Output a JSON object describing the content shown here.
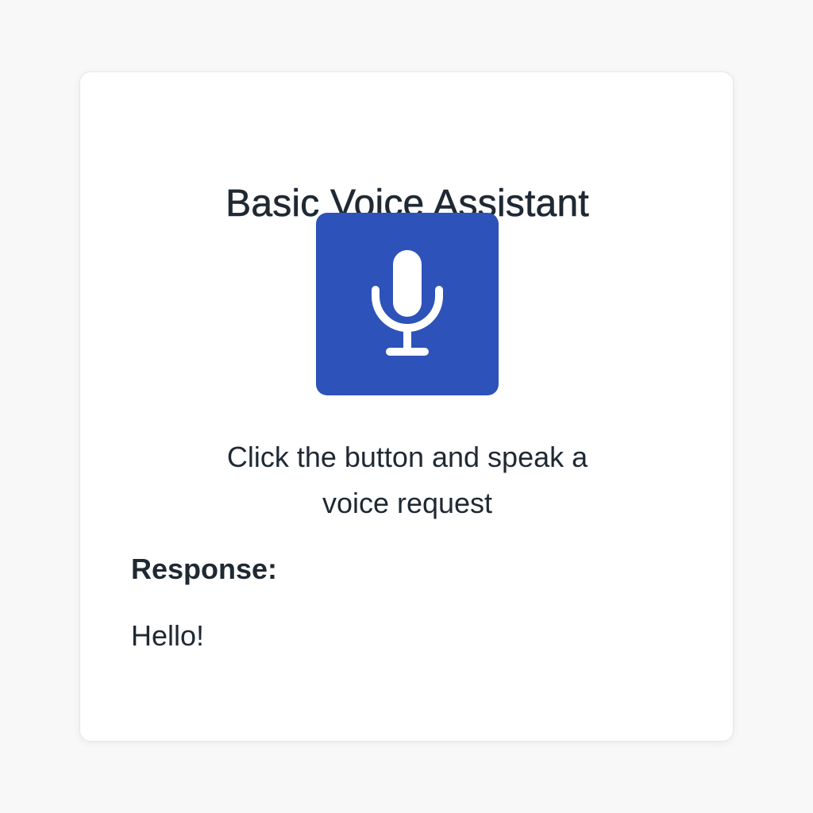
{
  "app": {
    "title": "Basic Voice Assistant"
  },
  "mic_button": {
    "icon": "microphone-icon",
    "color": "#2d52b9"
  },
  "instructions": {
    "line1": "Click the button and speak a",
    "line2": "voice request"
  },
  "response": {
    "label": "Response:",
    "text": "Hello!"
  }
}
